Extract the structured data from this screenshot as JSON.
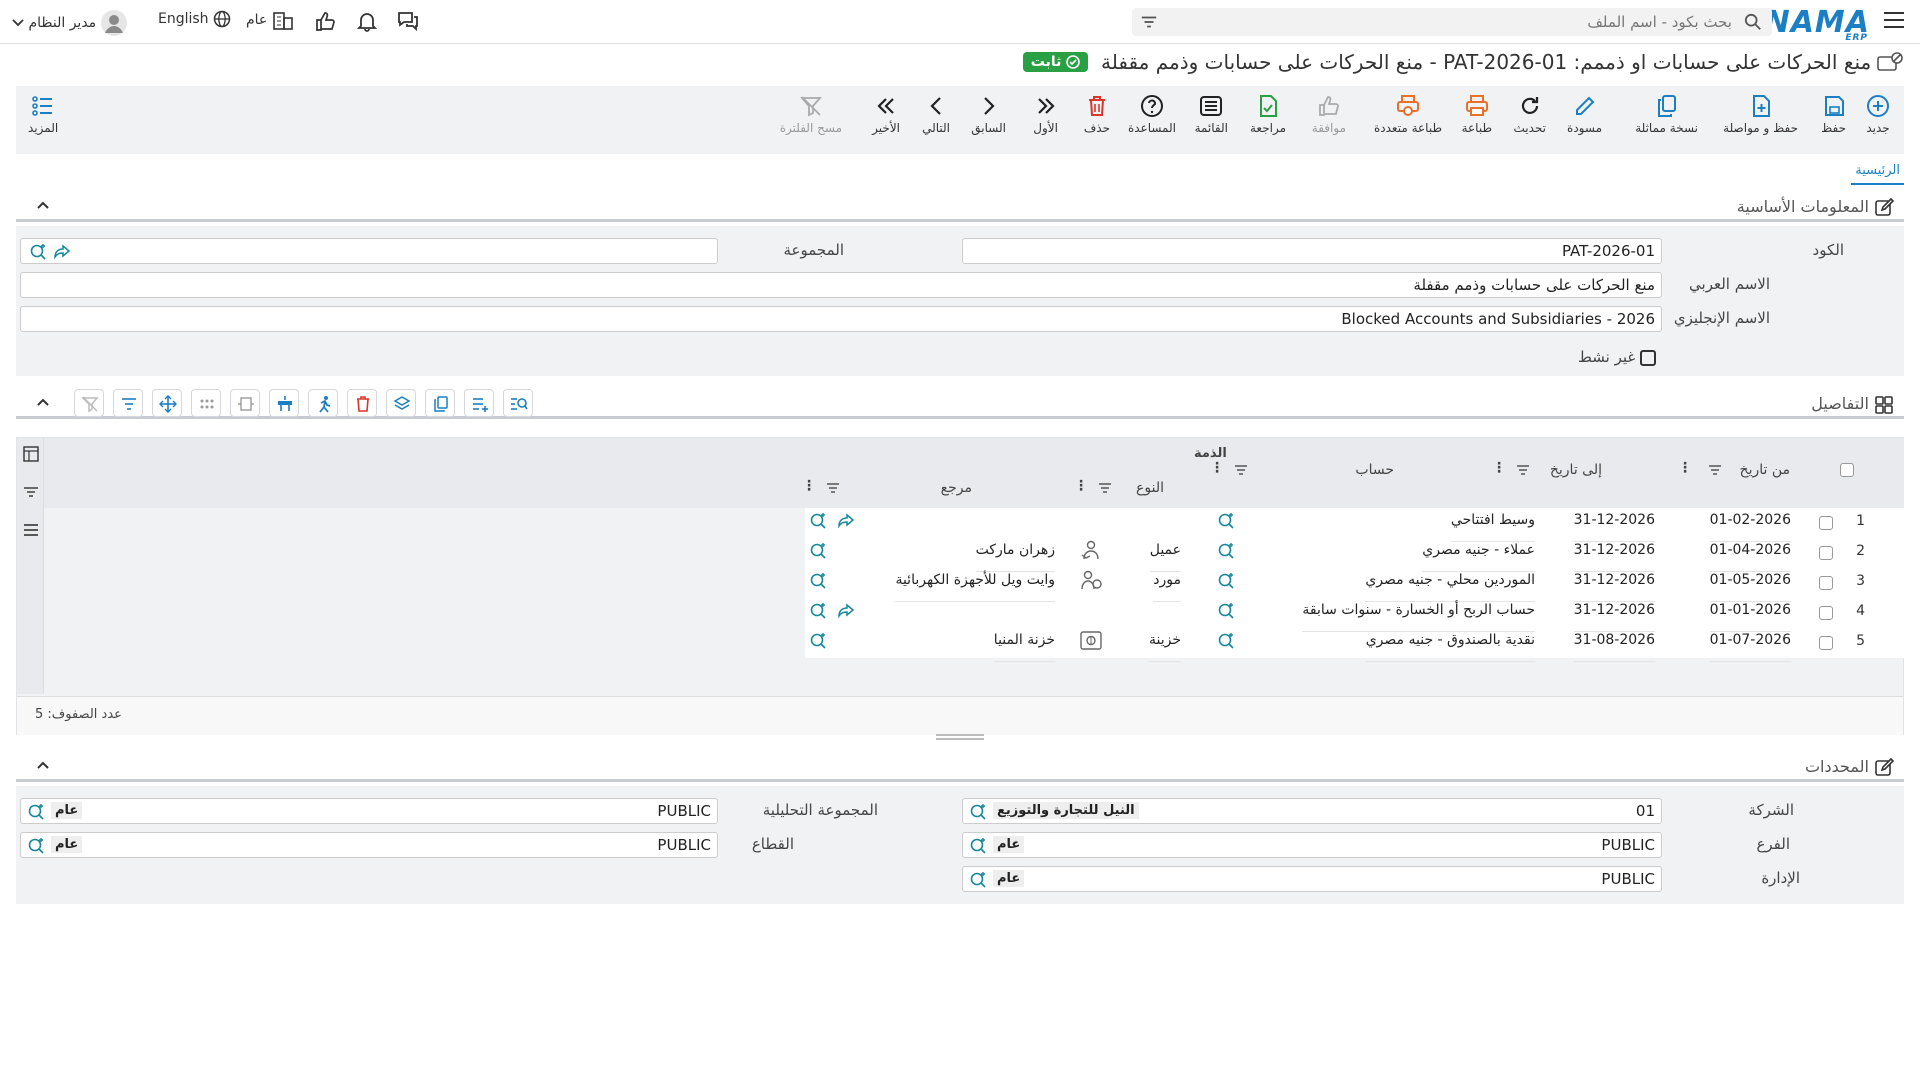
{
  "topbar": {
    "logo_text": "NAMA",
    "logo_sub": "ERP",
    "search_placeholder": "بحث بكود - اسم الملف",
    "user_name": "مدير النظام",
    "language": "English",
    "scope": "عام"
  },
  "page": {
    "title": "منع الحركات على حسابات او ذممم: PAT-2026-01 - منع الحركات على حسابات وذمم مقفلة",
    "status_badge": "ثابت",
    "status_color": "#2aa044"
  },
  "toolbar": {
    "new": "جديد",
    "save": "حفظ",
    "save_continue": "حفظ و مواصلة",
    "copy": "نسخة مماثلة",
    "draft": "مسودة",
    "refresh": "تحديث",
    "print": "طباعة",
    "multi_print": "طباعة متعددة",
    "approve": "موافقة",
    "review": "مراجعة",
    "list": "القائمة",
    "help": "المساعدة",
    "delete": "حذف",
    "first": "الأول",
    "previous": "السابق",
    "next": "التالي",
    "last": "الأخير",
    "clear_filter": "مسح الفلترة",
    "more": "المزيد"
  },
  "tabs": {
    "main": "الرئيسية"
  },
  "basic_info": {
    "section_title": "المعلومات الأساسية",
    "code_label": "الكود",
    "code_value": "PAT-2026-01",
    "group_label": "المجموعة",
    "group_value": "",
    "arabic_name_label": "الاسم العربي",
    "arabic_name_value": "منع الحركات على حسابات وذمم مقفلة",
    "english_name_label": "الاسم الإنجليزي",
    "english_name_value": "Blocked Accounts and Subsidiaries - 2026",
    "inactive_label": "غير نشط"
  },
  "details": {
    "section_title": "التفاصيل",
    "columns": {
      "from_date": "من تاريخ",
      "to_date": "إلى تاريخ",
      "account": "حساب",
      "subsidiary_group": "الذمة",
      "type": "النوع",
      "reference": "مرجع"
    },
    "rows": [
      {
        "n": "1",
        "from": "01-02-2026",
        "to": "31-12-2026",
        "account": "وسيط افتتاحي",
        "type": "",
        "ref": ""
      },
      {
        "n": "2",
        "from": "01-04-2026",
        "to": "31-12-2026",
        "account": "عملاء - جنيه مصري",
        "type": "عميل",
        "ref": "زهران ماركت"
      },
      {
        "n": "3",
        "from": "01-05-2026",
        "to": "31-12-2026",
        "account": "الموردين محلي - جنيه مصري",
        "type": "مورد",
        "ref": "وايت ويل للأجهزة الكهربائية"
      },
      {
        "n": "4",
        "from": "01-01-2026",
        "to": "31-12-2026",
        "account": "حساب الربح أو الخسارة - سنوات سابقة",
        "type": "",
        "ref": ""
      },
      {
        "n": "5",
        "from": "01-07-2026",
        "to": "31-08-2026",
        "account": "نقدية بالصندوق - جنيه مصري",
        "type": "خزينة",
        "ref": "خزنة المنيا"
      }
    ],
    "row_count_label": "عدد الصفوف: 5"
  },
  "determinants": {
    "section_title": "المحددات",
    "company_label": "الشركة",
    "company_code": "01",
    "company_name": "النيل للتجارة والتوزيع",
    "branch_label": "الفرع",
    "branch_code": "PUBLIC",
    "branch_name": "عام",
    "department_label": "الإدارة",
    "department_code": "PUBLIC",
    "department_name": "عام",
    "analytic_group_label": "المجموعة التحليلية",
    "analytic_group_code": "PUBLIC",
    "analytic_group_name": "عام",
    "sector_label": "القطاع",
    "sector_code": "PUBLIC",
    "sector_name": "عام"
  },
  "colors": {
    "accent": "#1c7fc4",
    "danger": "#d9372b",
    "success": "#2aa044",
    "teal": "#17879b"
  }
}
